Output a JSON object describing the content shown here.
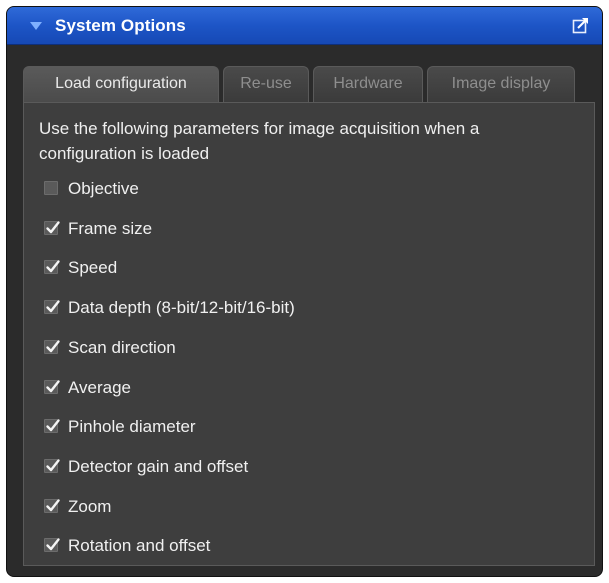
{
  "panel": {
    "title": "System Options",
    "accent": "#1f58c8"
  },
  "tabs": [
    {
      "label": "Load configuration",
      "active": true
    },
    {
      "label": "Re-use",
      "active": false
    },
    {
      "label": "Hardware",
      "active": false
    },
    {
      "label": "Image display",
      "active": false
    }
  ],
  "content": {
    "intro": "Use the following parameters for image acquisition when a configuration is loaded",
    "options": [
      {
        "label": "Objective",
        "checked": false
      },
      {
        "label": "Frame size",
        "checked": true
      },
      {
        "label": "Speed",
        "checked": true
      },
      {
        "label": "Data depth (8-bit/12-bit/16-bit)",
        "checked": true
      },
      {
        "label": "Scan direction",
        "checked": true
      },
      {
        "label": "Average",
        "checked": true
      },
      {
        "label": "Pinhole diameter",
        "checked": true
      },
      {
        "label": "Detector gain and offset",
        "checked": true
      },
      {
        "label": "Zoom",
        "checked": true
      },
      {
        "label": "Rotation and offset",
        "checked": true
      }
    ]
  },
  "icons": {
    "collapse": "collapse-arrow-icon",
    "undock": "undock-window-icon",
    "check": "checkmark-icon"
  }
}
